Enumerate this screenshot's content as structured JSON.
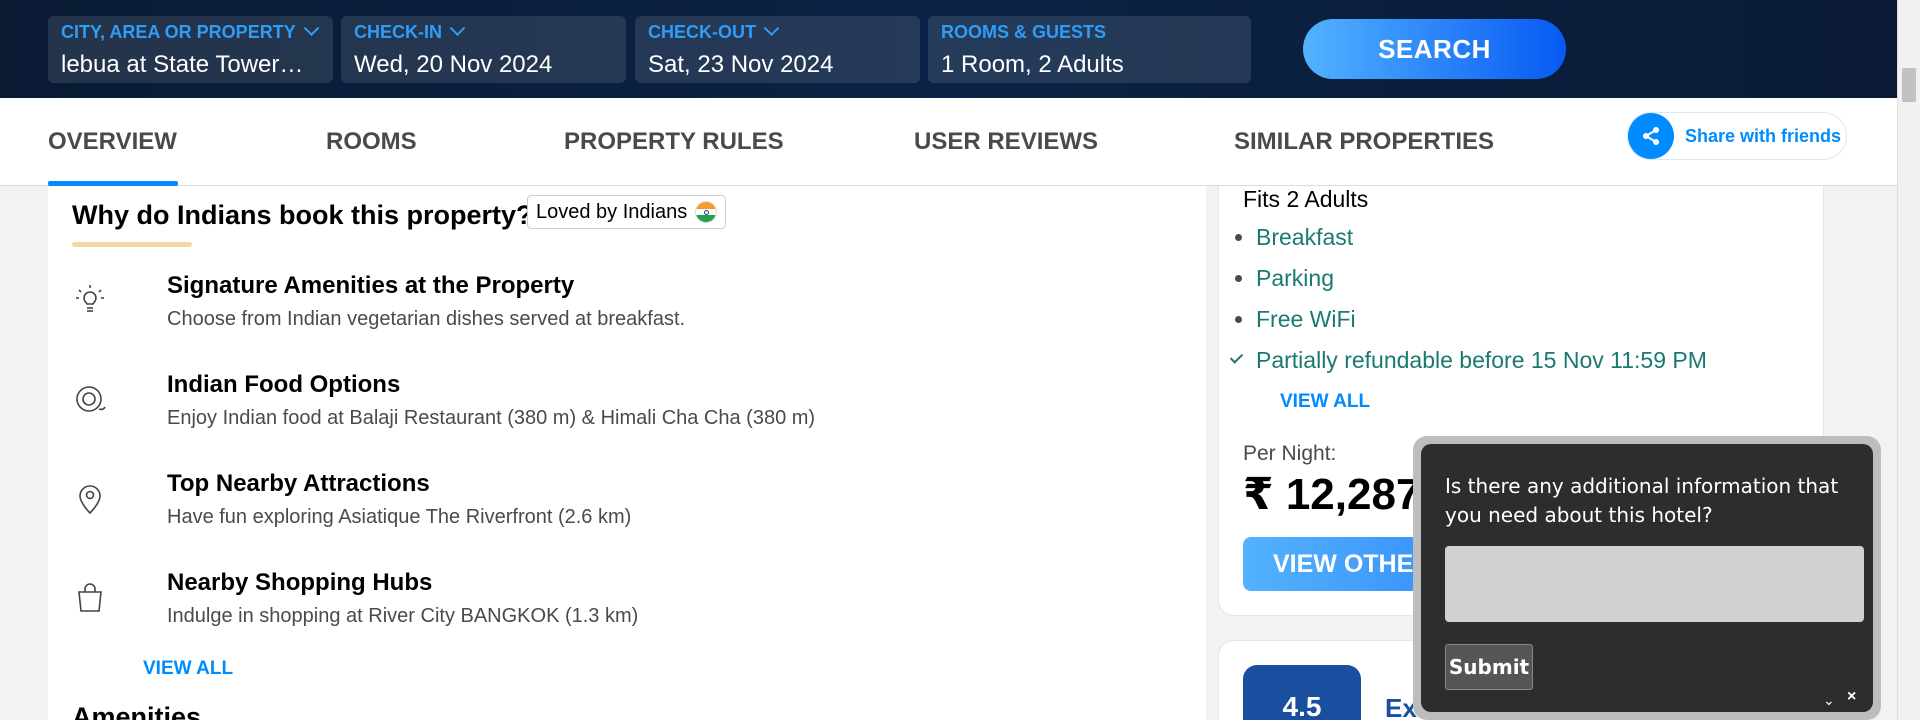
{
  "search": {
    "city": {
      "label": "CITY, AREA OR PROPERTY",
      "value": "lebua at State Tower…"
    },
    "checkin": {
      "label": "CHECK-IN",
      "value": "Wed, 20 Nov 2024"
    },
    "checkout": {
      "label": "CHECK-OUT",
      "value": "Sat, 23 Nov 2024"
    },
    "guests": {
      "label": "ROOMS & GUESTS",
      "value": "1 Room, 2 Adults"
    },
    "button": "SEARCH"
  },
  "tabs": [
    {
      "label": "OVERVIEW",
      "active": true
    },
    {
      "label": "ROOMS"
    },
    {
      "label": "PROPERTY RULES"
    },
    {
      "label": "USER REVIEWS"
    },
    {
      "label": "SIMILAR PROPERTIES"
    }
  ],
  "share": {
    "label": "Share with friends",
    "icon": "share-icon"
  },
  "why": {
    "title": "Why do Indians book this property?",
    "badge": "Loved by Indians",
    "features": [
      {
        "icon": "lightbulb-icon",
        "title": "Signature Amenities at the Property",
        "desc": "Choose from Indian vegetarian dishes served at breakfast."
      },
      {
        "icon": "food-plate-icon",
        "title": "Indian Food Options",
        "desc": "Enjoy Indian food at Balaji Restaurant (380 m) & Himali Cha Cha (380 m)"
      },
      {
        "icon": "location-pin-icon",
        "title": "Top Nearby Attractions",
        "desc": "Have fun exploring Asiatique The Riverfront (2.6 km)"
      },
      {
        "icon": "shopping-bag-icon",
        "title": "Nearby Shopping Hubs",
        "desc": "Indulge in shopping at River City BANGKOK (1.3 km)"
      }
    ],
    "view_all": "VIEW ALL"
  },
  "amenities_heading": "Amenities",
  "room": {
    "fits": "Fits 2 Adults",
    "items": [
      "Breakfast",
      "Parking",
      "Free WiFi"
    ],
    "refund": "Partially refundable before 15 Nov 11:59 PM",
    "view_all": "VIEW ALL",
    "per_night_label": "Per Night:",
    "price": "₹ 12,287",
    "view_other": "VIEW OTHER"
  },
  "rating": {
    "score": "4.5",
    "label": "Ex"
  },
  "popup": {
    "question": "Is there any additional information that you need about this hotel?",
    "submit": "Submit",
    "minimize": "⌄",
    "close": "×"
  },
  "colors": {
    "brand_blue": "#008cff",
    "header_bg": "#0b2346",
    "teal": "#1a7971"
  }
}
